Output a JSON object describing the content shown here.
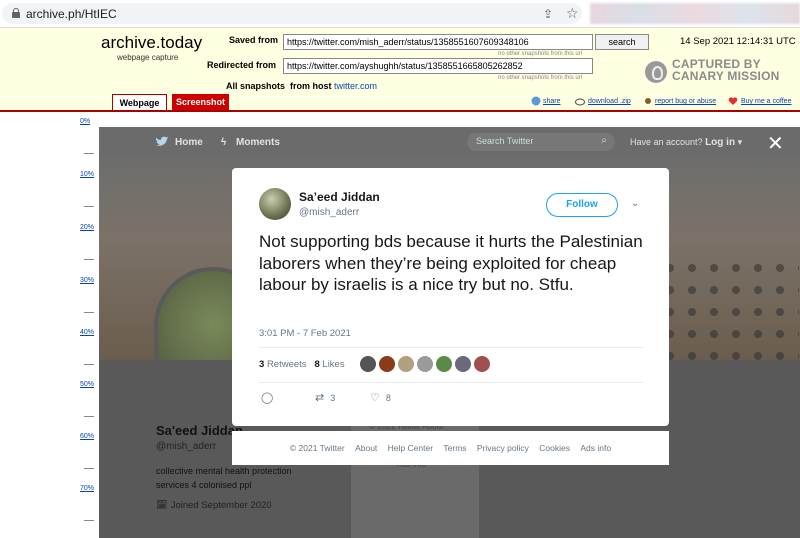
{
  "browser": {
    "url": "archive.ph/HtIEC"
  },
  "archive": {
    "logo": "archive.today",
    "logo_sub": "webpage capture",
    "saved_from_label": "Saved from",
    "saved_from_url": "https://twitter.com/mish_aderr/status/1358551607609348106",
    "saved_note": "no other snapshots from this url",
    "redirected_from_label": "Redirected from",
    "redirected_from_url": "https://twitter.com/ayshughh/status/1358551665805262852",
    "redirected_note": "no other snapshots from this url",
    "all_snapshots_label": "All snapshots",
    "from_host_label": "from host",
    "host": "twitter.com",
    "search_label": "search",
    "date": "14 Sep 2021 12:14:31 UTC",
    "canary_line1": "CAPTURED BY",
    "canary_line2": "CANARY MISSION",
    "tabs": {
      "webpage": "Webpage",
      "screenshot": "Screenshot"
    },
    "actions": {
      "share": "share",
      "download": "download .zip",
      "report": "report bug or abuse",
      "coffee": "Buy me a coffee"
    },
    "ruler": [
      "0%",
      "10%",
      "20%",
      "30%",
      "40%",
      "50%",
      "60%",
      "70%"
    ]
  },
  "twitter": {
    "nav": {
      "home": "Home",
      "moments": "Moments",
      "search_placeholder": "Search Twitter",
      "have_account": "Have an account?",
      "login": "Log in"
    },
    "profile": {
      "name": "Sa'eed Jiddan",
      "handle": "@mish_aderr",
      "bio_line1": "collective mental health protection",
      "bio_line2": "services 4 colonised ppl",
      "joined": "Joined September 2020",
      "side_text": "© 2021 Twitter  About",
      "side_text2": "Ads info"
    },
    "tweet": {
      "name": "Sa’eed Jiddan",
      "handle": "@mish_aderr",
      "follow_label": "Follow",
      "text": "Not supporting bds because it hurts the Palestinian laborers when they’re being exploited for cheap labour by israelis is a nice try but no. Stfu.",
      "time": "3:01 PM - 7 Feb 2021",
      "retweets_count": "3",
      "retweets_label": "Retweets",
      "likes_count": "8",
      "likes_label": "Likes",
      "reply_count": "",
      "retweet_action_count": "3",
      "like_action_count": "8",
      "liker_colors": [
        "#555555",
        "#8a3b1a",
        "#b0a080",
        "#9a9a9a",
        "#5a8a4a",
        "#6a6a7a",
        "#a05050"
      ]
    },
    "footer": [
      "© 2021 Twitter",
      "About",
      "Help Center",
      "Terms",
      "Privacy policy",
      "Cookies",
      "Ads info"
    ]
  }
}
